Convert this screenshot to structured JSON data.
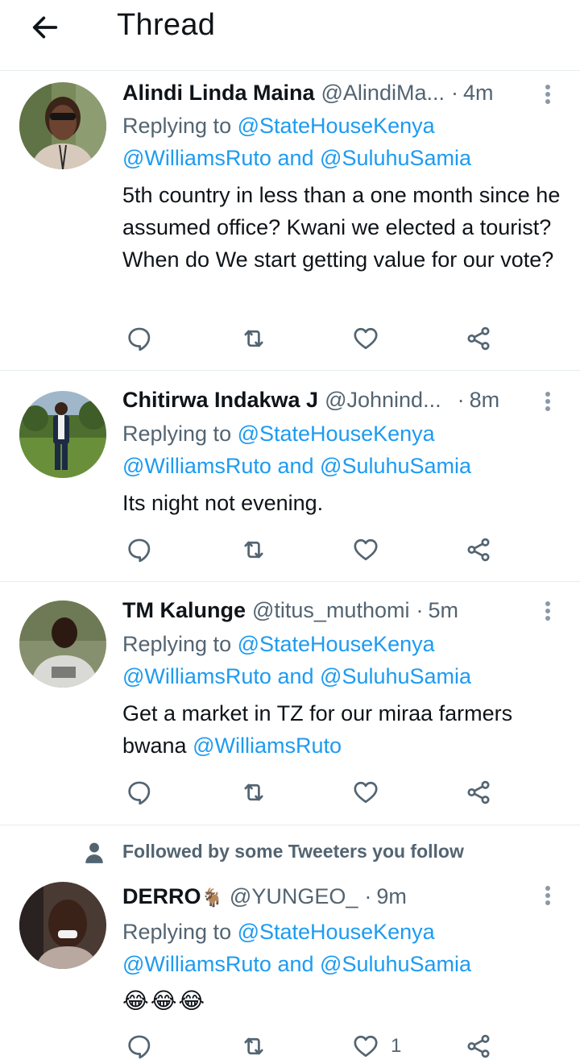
{
  "header": {
    "title": "Thread",
    "back_icon": "arrow-left-icon"
  },
  "tweets": [
    {
      "name": "Alindi Linda Maina",
      "handle": "@AlindiMa...",
      "time": "4m",
      "reply_prefix": "Replying to",
      "reply_to_1": "@StateHouseKenya",
      "reply_to_2": "@WilliamsRuto",
      "reply_and": "and",
      "reply_to_3": "@SuluhuSamia",
      "text": "5th country in less than a one month since he assumed office? Kwani we elected a tourist? When do We start getting value for our vote?"
    },
    {
      "name": "Chitirwa Indakwa J",
      "handle": "@Johnind...",
      "time": "8m",
      "reply_prefix": "Replying to",
      "reply_to_1": "@StateHouseKenya",
      "reply_to_2": "@WilliamsRuto",
      "reply_and": "and",
      "reply_to_3": "@SuluhuSamia",
      "text": "Its night not evening."
    },
    {
      "name": "TM Kalunge",
      "handle": "@titus_muthomi",
      "time": "5m",
      "reply_prefix": "Replying to",
      "reply_to_1": "@StateHouseKenya",
      "reply_to_2": "@WilliamsRuto",
      "reply_and": "and",
      "reply_to_3": "@SuluhuSamia",
      "text": "Get a market in TZ for our miraa farmers bwana",
      "text_mention": "@WilliamsRuto"
    },
    {
      "social_context": "Followed by some Tweeters you follow",
      "name": "DERRO",
      "name_emoji": "🐐",
      "handle": "@YUNGEO_",
      "time": "9m",
      "reply_prefix": "Replying to",
      "reply_to_1": "@StateHouseKenya",
      "reply_to_2": "@WilliamsRuto",
      "reply_and": "and",
      "reply_to_3": "@SuluhuSamia",
      "emoji_text": "😂😂😂",
      "like_count": "1"
    }
  ],
  "icons": {
    "reply": "reply-icon",
    "retweet": "retweet-icon",
    "like": "heart-icon",
    "share": "share-icon",
    "more": "more-vertical-icon",
    "social": "person-icon"
  },
  "colors": {
    "accent": "#1d9bf0",
    "text_primary": "#0f1419",
    "text_secondary": "#536471",
    "divider": "#e6ecf0"
  }
}
